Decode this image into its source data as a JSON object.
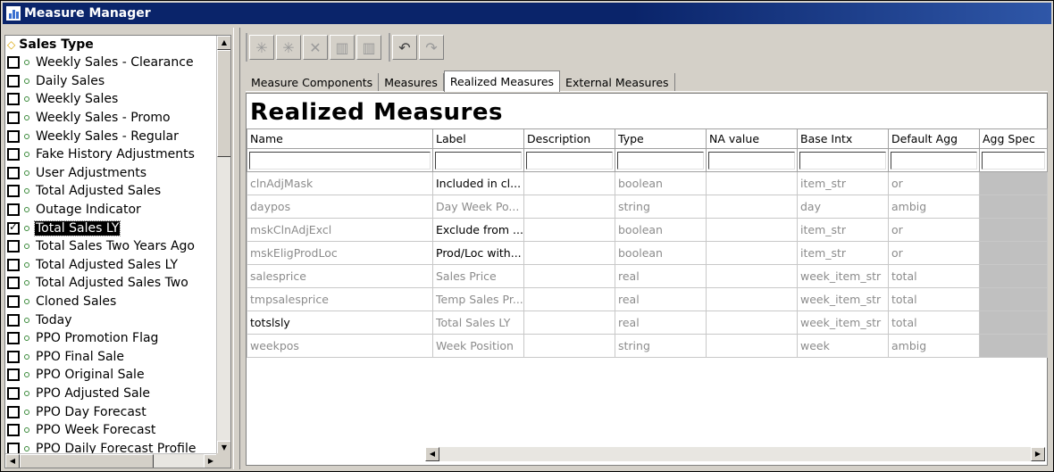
{
  "window": {
    "title": "Measure Manager",
    "icon": "bar-chart-icon"
  },
  "tree": {
    "header": "Sales Type",
    "items": [
      {
        "label": "Weekly Sales - Clearance",
        "checked": false
      },
      {
        "label": "Daily Sales",
        "checked": false
      },
      {
        "label": "Weekly Sales",
        "checked": false
      },
      {
        "label": "Weekly Sales - Promo",
        "checked": false
      },
      {
        "label": "Weekly Sales - Regular",
        "checked": false
      },
      {
        "label": "Fake History Adjustments",
        "checked": false
      },
      {
        "label": "User Adjustments",
        "checked": false
      },
      {
        "label": "Total Adjusted Sales",
        "checked": false
      },
      {
        "label": "Outage Indicator",
        "checked": false
      },
      {
        "label": "Total Sales LY",
        "checked": true,
        "selected": true
      },
      {
        "label": "Total Sales Two Years Ago",
        "checked": false
      },
      {
        "label": "Total Adjusted Sales LY",
        "checked": false
      },
      {
        "label": "Total Adjusted Sales Two",
        "checked": false
      },
      {
        "label": "Cloned Sales",
        "checked": false
      },
      {
        "label": "Today",
        "checked": false
      },
      {
        "label": "PPO Promotion Flag",
        "checked": false
      },
      {
        "label": "PPO Final Sale",
        "checked": false
      },
      {
        "label": "PPO Original Sale",
        "checked": false
      },
      {
        "label": "PPO Adjusted Sale",
        "checked": false
      },
      {
        "label": "PPO Day Forecast",
        "checked": false
      },
      {
        "label": "PPO Week Forecast",
        "checked": false
      },
      {
        "label": "PPO Daily Forecast Profile",
        "checked": false
      }
    ]
  },
  "toolbar": {
    "buttons": [
      {
        "name": "new-measure-icon",
        "glyph": "✳"
      },
      {
        "name": "copy-measure-icon",
        "glyph": "✳"
      },
      {
        "name": "delete-measure-icon",
        "glyph": "✕"
      },
      {
        "name": "chart-icon",
        "glyph": "▥"
      },
      {
        "name": "chart-alt-icon",
        "glyph": "▥"
      },
      {
        "name": "undo-icon",
        "glyph": "↶"
      },
      {
        "name": "redo-icon",
        "glyph": "↷"
      }
    ]
  },
  "tabs": [
    {
      "label": "Measure Components",
      "active": false
    },
    {
      "label": "Measures",
      "active": false
    },
    {
      "label": "Realized Measures",
      "active": true
    },
    {
      "label": "External Measures",
      "active": false
    }
  ],
  "panel_title": "Realized Measures",
  "table": {
    "columns": [
      "Name",
      "Label",
      "Description",
      "Type",
      "NA value",
      "Base Intx",
      "Default Agg",
      "Agg Spec"
    ],
    "rows": [
      {
        "name": "clnAdjMask",
        "label": "Included in cl...",
        "description": "",
        "type": "boolean",
        "na": "",
        "base": "item_str",
        "agg": "or",
        "label_dark": true,
        "name_dark": false
      },
      {
        "name": "daypos",
        "label": "Day Week Po...",
        "description": "",
        "type": "string",
        "na": "",
        "base": "day",
        "agg": "ambig",
        "label_dark": false,
        "name_dark": false
      },
      {
        "name": "mskClnAdjExcl",
        "label": "Exclude from ...",
        "description": "",
        "type": "boolean",
        "na": "",
        "base": "item_str",
        "agg": "or",
        "label_dark": true,
        "name_dark": false
      },
      {
        "name": "mskEligProdLoc",
        "label": "Prod/Loc with...",
        "description": "",
        "type": "boolean",
        "na": "",
        "base": "item_str",
        "agg": "or",
        "label_dark": true,
        "name_dark": false
      },
      {
        "name": "salesprice",
        "label": "Sales Price",
        "description": "",
        "type": "real",
        "na": "",
        "base": "week_item_str",
        "agg": "total",
        "label_dark": false,
        "name_dark": false
      },
      {
        "name": "tmpsalesprice",
        "label": "Temp Sales Pr...",
        "description": "",
        "type": "real",
        "na": "",
        "base": "week_item_str",
        "agg": "total",
        "label_dark": false,
        "name_dark": false
      },
      {
        "name": "totslsly",
        "label": "Total Sales LY",
        "description": "",
        "type": "real",
        "na": "",
        "base": "week_item_str",
        "agg": "total",
        "label_dark": false,
        "name_dark": true
      },
      {
        "name": "weekpos",
        "label": "Week Position",
        "description": "",
        "type": "string",
        "na": "",
        "base": "week",
        "agg": "ambig",
        "label_dark": false,
        "name_dark": false
      }
    ]
  }
}
